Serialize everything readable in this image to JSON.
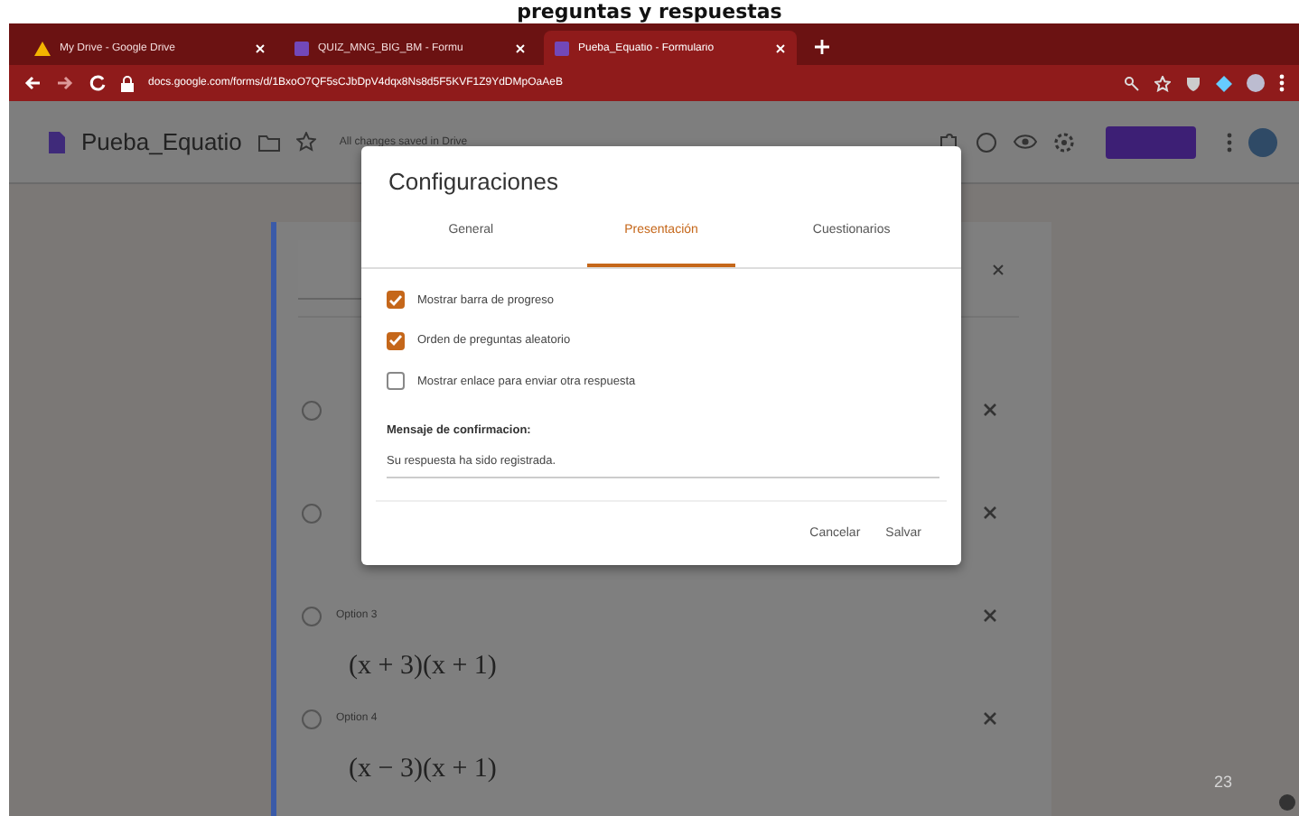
{
  "slide": {
    "title": "preguntas y respuestas",
    "page_number": "23"
  },
  "browser": {
    "tabs": [
      {
        "label": "My Drive - Google Drive",
        "selected": false
      },
      {
        "label": "QUIZ_MNG_BIG_BM - Formu",
        "selected": false
      },
      {
        "label": "Pueba_Equatio - Formulario",
        "selected": true
      }
    ],
    "url": "docs.google.com/forms/d/1BxoO7QF5sCJbDpV4dqx8Ns8d5F5KVF1Z9YdDMpOaAeB"
  },
  "form_header": {
    "title": "Pueba_Equatio",
    "save_status": "All changes saved in Drive"
  },
  "question": {
    "options": [
      {
        "selected": false
      },
      {
        "selected": false
      },
      {
        "label": "Option 3",
        "math": "(x + 3)(x + 1)",
        "selected": false
      },
      {
        "label": "Option 4",
        "math": "(x − 3)(x + 1)",
        "selected": false
      }
    ]
  },
  "dialog": {
    "title": "Configuraciones",
    "tabs": [
      {
        "label": "General",
        "selected": false
      },
      {
        "label": "Presentación",
        "selected": true
      },
      {
        "label": "Cuestionarios",
        "selected": false
      }
    ],
    "checkboxes": [
      {
        "label": "Mostrar barra de progreso",
        "checked": true
      },
      {
        "label": "Orden de preguntas aleatorio",
        "checked": true
      },
      {
        "label": "Mostrar enlace para enviar otra respuesta",
        "checked": false
      }
    ],
    "confirmation_label": "Mensaje de confirmacion:",
    "confirmation_message": "Su respuesta ha sido registrada.",
    "buttons": [
      "Cancelar",
      "Salvar"
    ]
  }
}
